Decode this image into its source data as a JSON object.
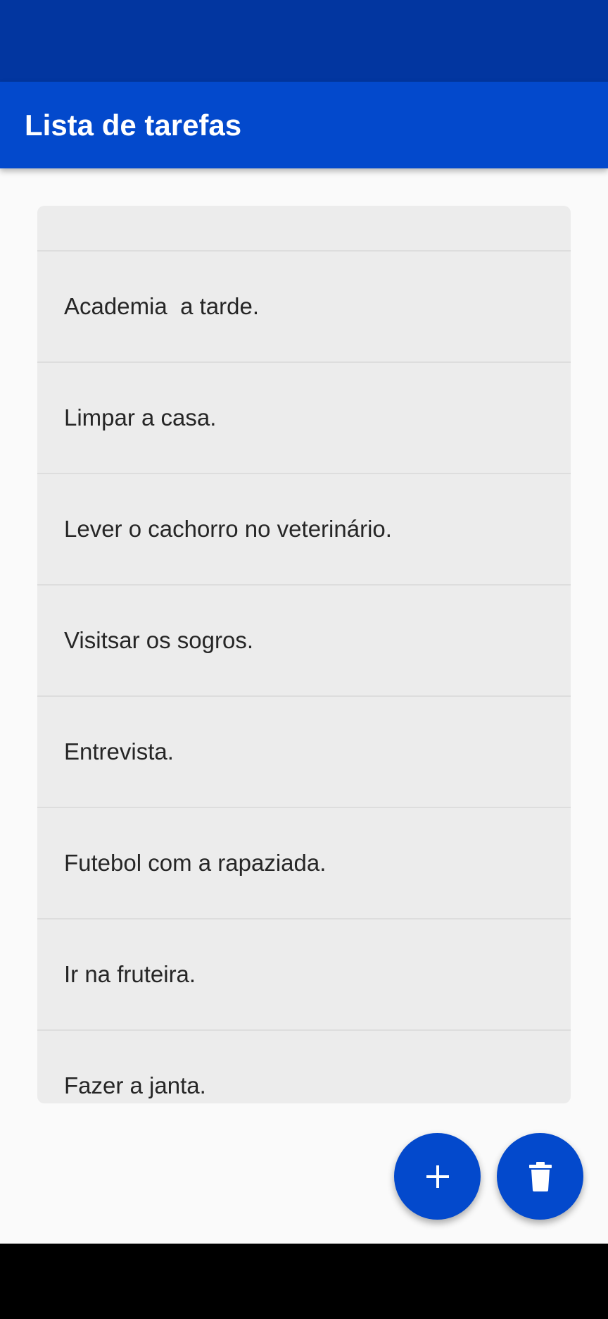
{
  "app_bar": {
    "title": "Lista de tarefas"
  },
  "tasks": [
    {
      "label": "."
    },
    {
      "label": "Academia  a tarde."
    },
    {
      "label": "Limpar a casa."
    },
    {
      "label": "Lever o cachorro no veterinário."
    },
    {
      "label": "Visitsar os sogros."
    },
    {
      "label": "Entrevista."
    },
    {
      "label": "Futebol com a rapaziada."
    },
    {
      "label": "Ir na fruteira."
    },
    {
      "label": "Fazer a janta."
    }
  ],
  "fabs": {
    "add_icon": "plus-icon",
    "delete_icon": "trash-icon"
  },
  "colors": {
    "primary": "#0349cc",
    "primary_dark": "#0236a0",
    "list_background": "#ececec",
    "page_background": "#fafafa"
  }
}
